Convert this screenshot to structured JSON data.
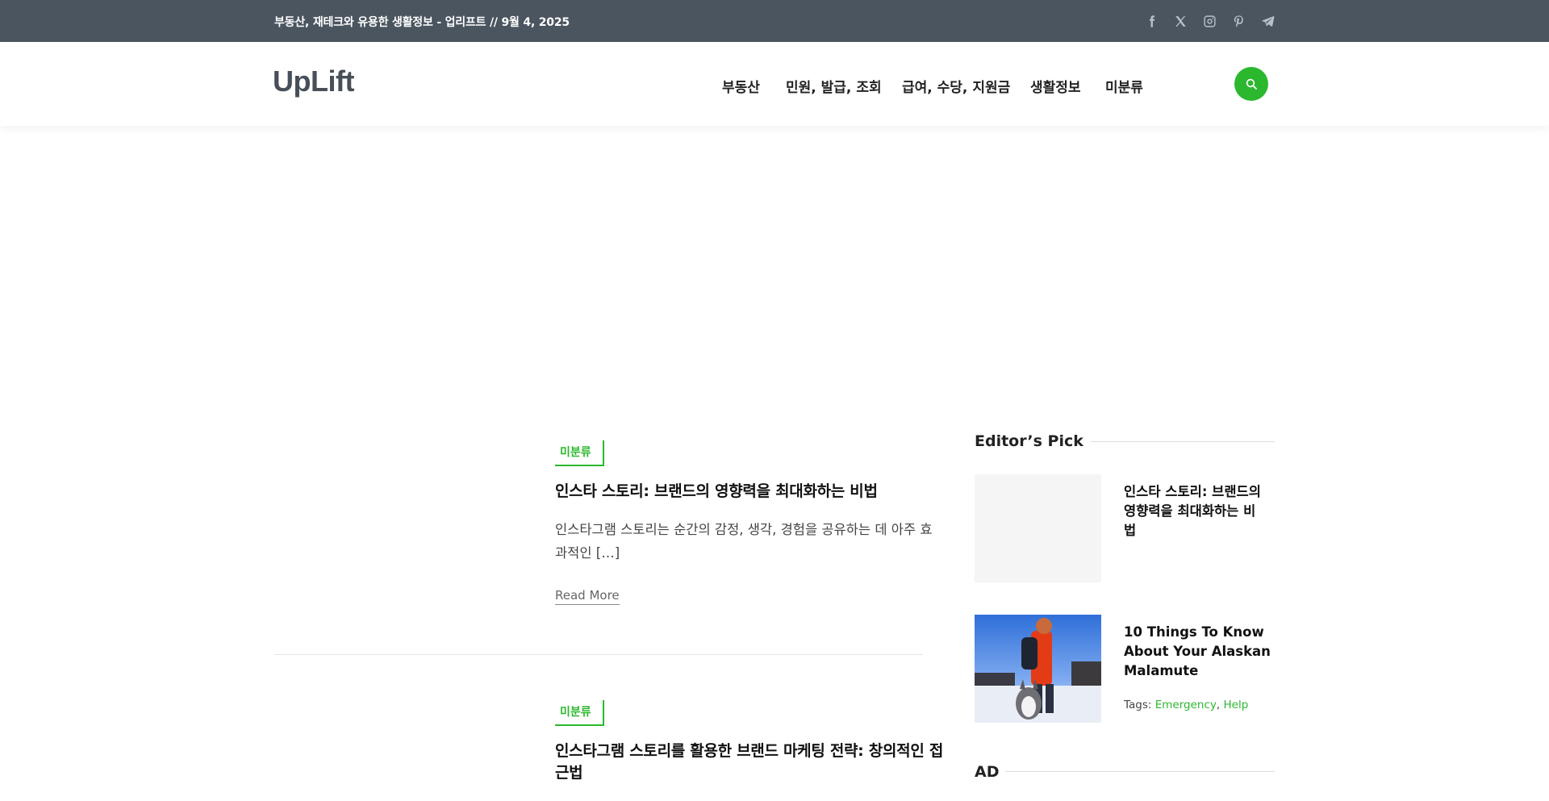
{
  "topbar": {
    "text": "부동산, 재테크와 유용한 생활정보 - 업리프트 // 9월 4, 2025",
    "social": [
      {
        "icon": "facebook-icon"
      },
      {
        "icon": "x-twitter-icon"
      },
      {
        "icon": "instagram-icon"
      },
      {
        "icon": "pinterest-icon"
      },
      {
        "icon": "telegram-icon"
      }
    ]
  },
  "header": {
    "logo": "UpLift",
    "nav": [
      "부동산",
      "민원, 발급, 조회",
      "급여, 수당, 지원금",
      "생활정보",
      "미분류"
    ],
    "search_icon": "search-icon"
  },
  "posts": [
    {
      "category": "미분류",
      "title": "인스타 스토리: 브랜드의 영향력을 최대화하는 비법",
      "excerpt_line1": "인스타그램 스토리는 순간의 감정, 생각, 경험을 공유하는 데 아주 효",
      "excerpt_line2": "과적인 […]",
      "read_more": "Read More"
    },
    {
      "category": "미분류",
      "title_line1": "인스타그램 스토리를 활용한 브랜드 마케팅 전략: 창의적인 접",
      "title_line2": "근법"
    }
  ],
  "sidebar": {
    "editors_pick_title": "Editor’s Pick",
    "picks": [
      {
        "title_line1": "인스타 스토리: 브랜드의",
        "title_line2": "영향력을 최대화하는 비",
        "title_line3": "법"
      },
      {
        "title_line1": "10 Things To Know",
        "title_line2": "About Your Alaskan",
        "title_line3": "Malamute",
        "tags_label": "Tags:",
        "tags": [
          "Emergency",
          "Help"
        ],
        "tag_sep": ","
      }
    ],
    "ad_title": "AD"
  },
  "colors": {
    "topbar_bg": "#4a5560",
    "accent": "#2bb82f",
    "logo": "#474f58"
  }
}
